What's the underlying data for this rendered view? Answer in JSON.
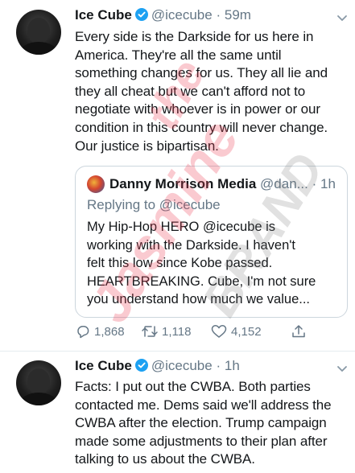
{
  "tweets": [
    {
      "name": "Ice Cube",
      "handle": "@icecube",
      "separator": "·",
      "time": "59m",
      "text": "Every side is the Darkside for us here in\nAmerica. They're all the same until\nsomething changes for us. They all lie and\nthey all cheat but we can't afford not to\nnegotiate with whoever is in power or our\ncondition in this country will never change.\nOur justice is bipartisan.",
      "quote": {
        "name": "Danny Morrison Media",
        "handle": "@dan...",
        "separator": "·",
        "time": "1h",
        "replying_to": "Replying to @icecube",
        "text": "My Hip-Hop HERO @icecube is\nworking with the Darkside. I haven't\nfelt this low since Kobe passed.\nHEARTBREAKING. Cube, I'm not sure\nyou understand how much we value..."
      },
      "actions": {
        "replies": "1,868",
        "retweets": "1,118",
        "likes": "4,152"
      }
    },
    {
      "name": "Ice Cube",
      "handle": "@icecube",
      "separator": "·",
      "time": "1h",
      "text": "Facts: I put out the CWBA. Both parties\ncontacted me. Dems said we'll address the\nCWBA after the election. Trump campaign\nmade some adjustments to their plan after\ntalking to us about the CWBA."
    }
  ],
  "watermark": {
    "line1": "the",
    "line2": "Jasmine",
    "line3": "BRAND"
  },
  "colors": {
    "verified": "#1da1f2",
    "secondary_text": "#657786",
    "border": "#ccd6dd",
    "watermark_pink": "#ec4056"
  }
}
